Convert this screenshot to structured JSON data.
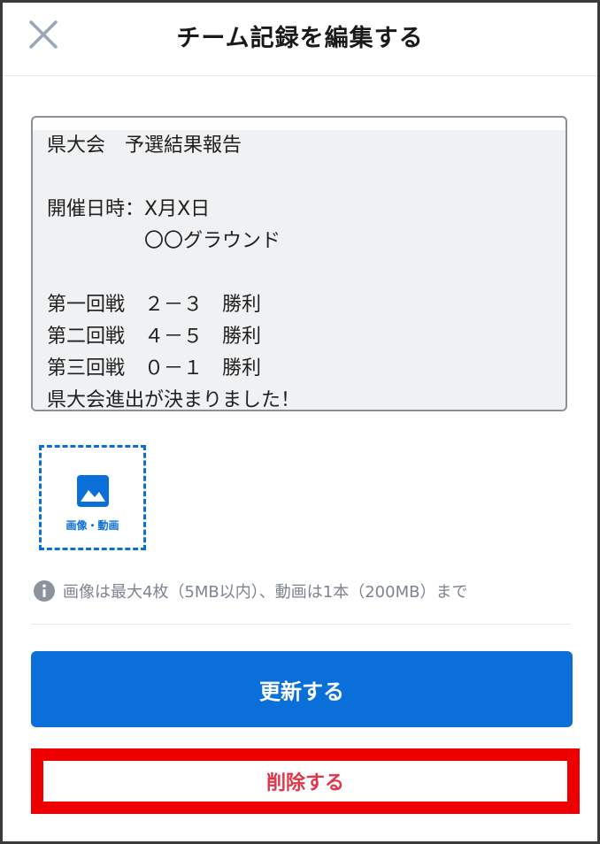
{
  "header": {
    "title": "チーム記録を編集する",
    "close_icon": "close-icon"
  },
  "post": {
    "body": "県大会　予選結果報告\n\n開催日時：X月X日\n　　　　　〇〇グラウンド\n\n第一回戦　２－３　勝利\n第二回戦　４－５　勝利\n第三回戦　０－１　勝利\n県大会進出が決まりました！"
  },
  "media": {
    "label": "画像・動画",
    "icon": "image-icon"
  },
  "note": {
    "icon": "info-icon",
    "text": "画像は最大4枚（5MB以内）、動画は1本（200MB）まで"
  },
  "actions": {
    "update_label": "更新する",
    "delete_label": "削除する"
  },
  "colors": {
    "accent": "#0b6fd9",
    "delete_text": "#e0364a",
    "highlight": "#ee0000",
    "muted_text": "#7d8390"
  }
}
